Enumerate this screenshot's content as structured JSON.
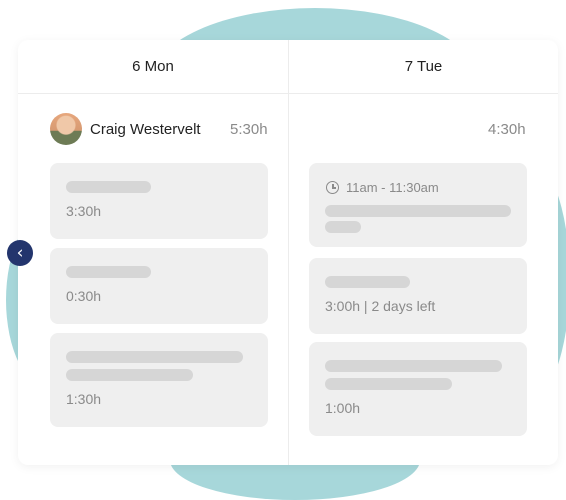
{
  "columns": [
    {
      "day": "6 Mon",
      "user_name": "Craig Westervelt",
      "total": "5:30h",
      "entries": [
        {
          "duration": "3:30h"
        },
        {
          "duration": "0:30h"
        },
        {
          "duration": "1:30h"
        }
      ]
    },
    {
      "day": "7 Tue",
      "total": "4:30h",
      "entries": [
        {
          "time_range": "11am - 11:30am"
        },
        {
          "duration": "3:00h | 2 days left"
        },
        {
          "duration": "1:00h"
        }
      ]
    }
  ],
  "icons": {
    "nav_prev": "chevron-left-icon",
    "time": "clock-icon"
  },
  "colors": {
    "accent": "#23356d",
    "blob": "#a7d7da",
    "entry_bg": "#efefef",
    "placeholder": "#d6d6d6"
  }
}
